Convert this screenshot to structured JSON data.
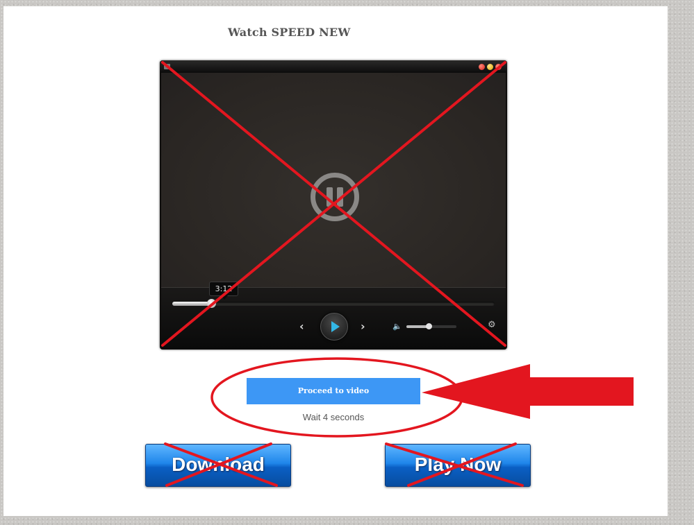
{
  "page": {
    "title": "Watch SPEED NEW"
  },
  "player": {
    "current_time_tooltip": "3:12",
    "progress_fraction": 0.12,
    "volume_fraction": 0.45,
    "icons": {
      "prev": "chevron-left-icon",
      "next": "chevron-right-icon",
      "play": "play-icon",
      "volume": "volume-icon",
      "settings": "gear-icon",
      "center": "pause-icon"
    },
    "glyphs": {
      "prev": "‹",
      "next": "›",
      "volume": "🔈",
      "settings": "⚙"
    }
  },
  "proceed": {
    "button_label": "Proceed to video",
    "wait_text": "Wait 4 seconds"
  },
  "buttons": {
    "download_label": "Download",
    "play_now_label": "Play Now"
  },
  "colors": {
    "proceed_button": "#3d97f5",
    "annotation_red": "#e3161f",
    "play_accent": "#33b7e6"
  }
}
